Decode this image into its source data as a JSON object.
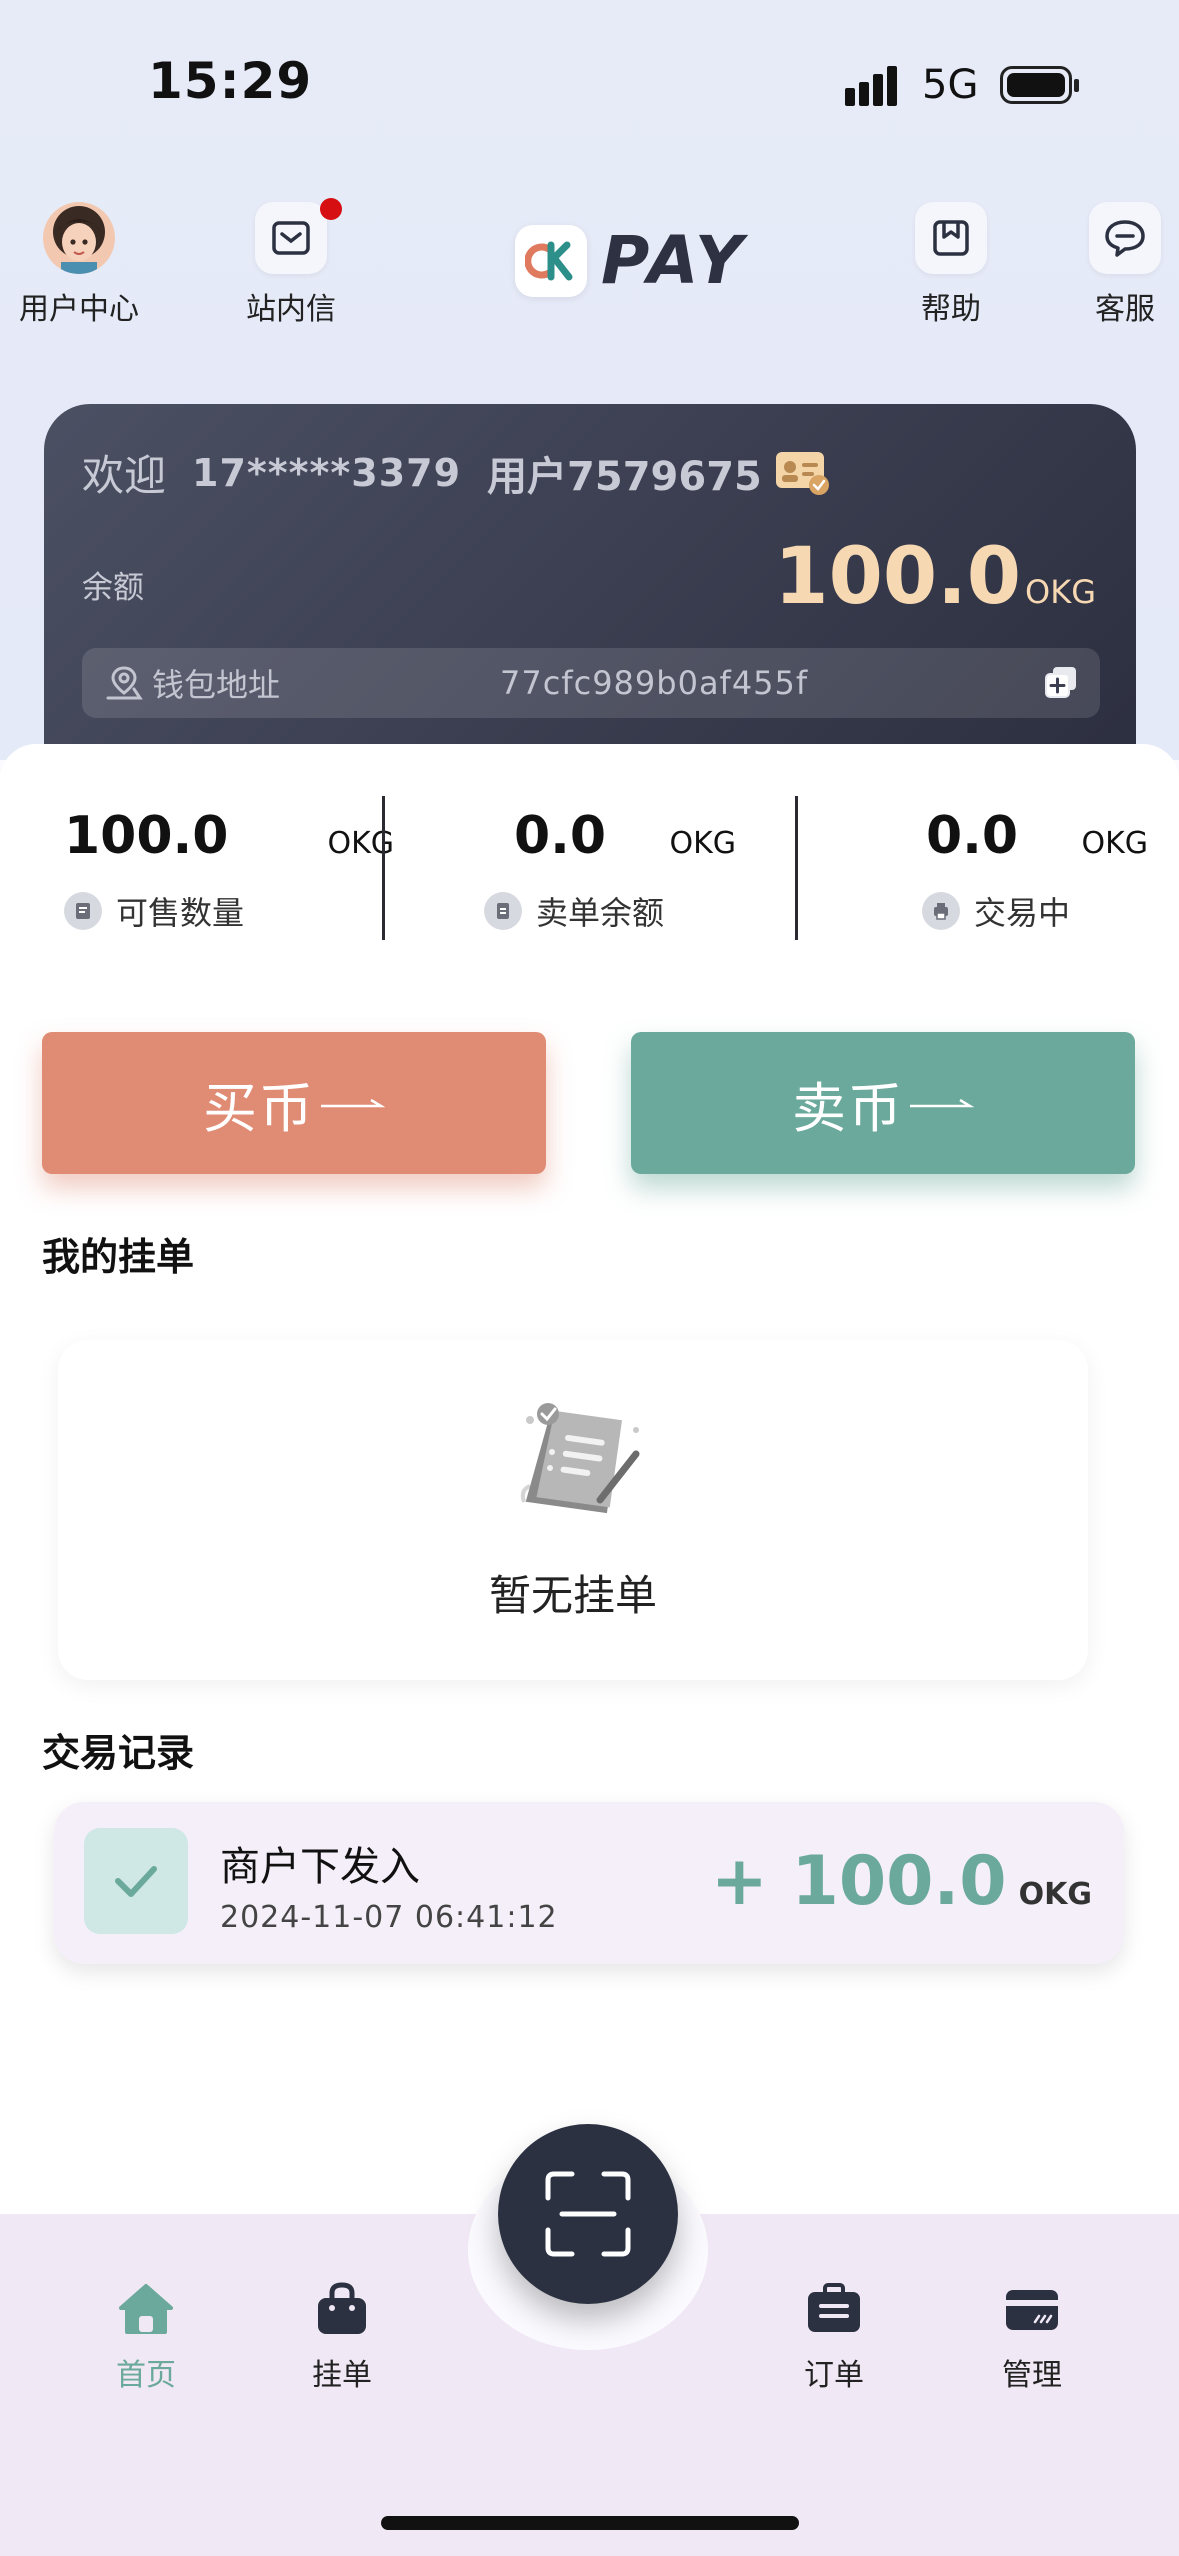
{
  "status_bar": {
    "time": "15:29",
    "network": "5G"
  },
  "header": {
    "user_center": "用户中心",
    "inbox": "站内信",
    "logo_text": "PAY",
    "help": "帮助",
    "service": "客服"
  },
  "account": {
    "welcome": "欢迎",
    "phone": "17*****3379",
    "username": "用户7579675",
    "balance_label": "余额",
    "balance": "100.0",
    "balance_unit": "OKG",
    "wallet_label": "钱包地址",
    "wallet_address": "77cfc989b0af455f"
  },
  "stats": [
    {
      "value": "100.0",
      "unit": "OKG",
      "label": "可售数量"
    },
    {
      "value": "0.0",
      "unit": "OKG",
      "label": "卖单余额"
    },
    {
      "value": "0.0",
      "unit": "OKG",
      "label": "交易中"
    }
  ],
  "actions": {
    "buy": "买币",
    "sell": "卖币"
  },
  "my_orders": {
    "title": "我的挂单",
    "empty_text": "暂无挂单"
  },
  "records": {
    "title": "交易记录",
    "items": [
      {
        "title": "商户下发入",
        "time": "2024-11-07 06:41:12",
        "amount": "+ 100.0",
        "unit": "OKG"
      }
    ]
  },
  "tabbar": {
    "home": "首页",
    "orders_list": "挂单",
    "orders": "订单",
    "manage": "管理"
  },
  "colors": {
    "accent": "#6aa99b",
    "buy": "#e08c75",
    "sell": "#6aa99b",
    "card_dark": "#3b3f51"
  }
}
